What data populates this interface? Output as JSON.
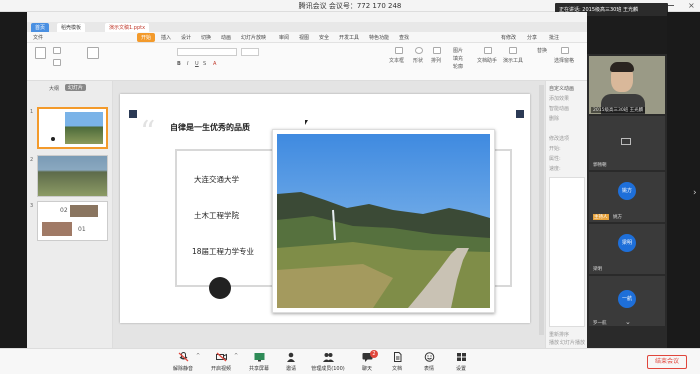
{
  "window": {
    "title": "腾讯会议 会议号：772 170 248",
    "speaking_toast": "正在讲话: 2015级高三30班 王光麟"
  },
  "ppt": {
    "doc_tabs": [
      "首页",
      "稻壳模板",
      "演示文稿1.pptx"
    ],
    "menus": [
      "文件",
      "开始",
      "插入",
      "设计",
      "切换",
      "动画",
      "幻灯片放映",
      "审阅",
      "视图",
      "安全",
      "开发工具",
      "特色功能",
      "查找"
    ],
    "active_menu": "开始",
    "right_actions": [
      "有修改",
      "分享",
      "批注"
    ],
    "toolbar": {
      "labels": [
        "文本框",
        "形状",
        "排列",
        "图片",
        "填充",
        "轮廓",
        "文档助手",
        "演示工具",
        "替换",
        "选择窗格"
      ]
    },
    "thumb_tabs": [
      "大纲",
      "幻灯片"
    ],
    "thumb_numbers": [
      "1",
      "2",
      "3"
    ],
    "slide3_labels": [
      "02",
      "01"
    ],
    "slide": {
      "title": "自律是一生优秀的品质",
      "lines": [
        "大连交通大学",
        "土木工程学院",
        "18届工程力学专业"
      ]
    },
    "taskpane": {
      "items": [
        "自定义动画",
        "添加效果",
        "智能动画",
        "删除",
        "修改选项",
        "开始:",
        "属性:",
        "速度:",
        "重新排序",
        "播放",
        "幻灯片播放"
      ]
    }
  },
  "video": {
    "participants": [
      {
        "name": "2015级高三30班 王光麟",
        "type": "camera"
      },
      {
        "name": "郭畅朝",
        "type": "muted-camera"
      },
      {
        "name": "姚方",
        "type": "avatar",
        "initials": "姚方",
        "badge": "主持人"
      },
      {
        "name": "梁明",
        "type": "avatar",
        "initials": "梁明"
      },
      {
        "name": "罗一航",
        "type": "avatar",
        "initials": "一航"
      }
    ]
  },
  "meeting_bar": {
    "buttons": [
      {
        "label": "解除静音",
        "icon": "mic-muted-icon"
      },
      {
        "label": "开启视频",
        "icon": "video-off-icon"
      },
      {
        "label": "共享屏幕",
        "icon": "screen-share-icon"
      },
      {
        "label": "邀请",
        "icon": "invite-icon"
      },
      {
        "label": "管理成员(100)",
        "icon": "members-icon"
      },
      {
        "label": "聊天",
        "icon": "chat-icon",
        "badge": "2"
      },
      {
        "label": "文档",
        "icon": "document-icon"
      },
      {
        "label": "表情",
        "icon": "emoji-icon"
      },
      {
        "label": "设置",
        "icon": "settings-icon"
      }
    ],
    "end_label": "结束会议"
  },
  "colors": {
    "accent_blue": "#1e6fd9",
    "end_red": "#e0463c",
    "active_menu_orange": "#f39a2b"
  }
}
